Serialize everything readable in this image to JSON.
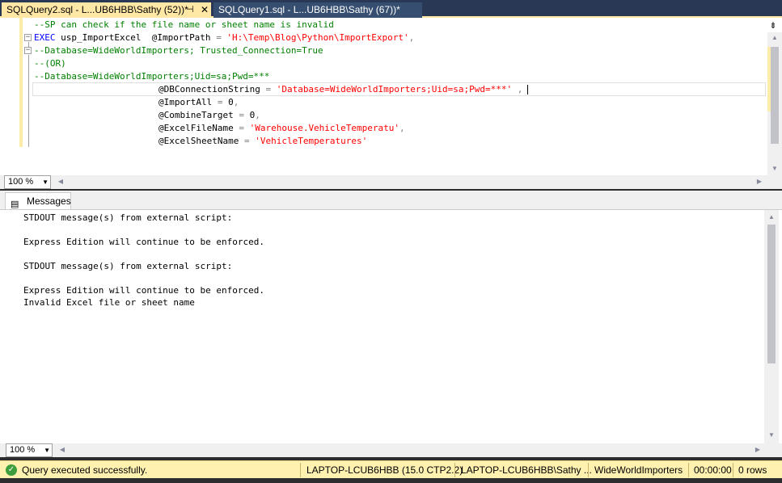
{
  "tabs": [
    {
      "label": "SQLQuery2.sql - L...UB6HBB\\Sathy (52))*",
      "pin": "⊣",
      "close": "✕"
    },
    {
      "label": "SQLQuery1.sql - L...UB6HBB\\Sathy (67))*"
    }
  ],
  "editor": {
    "lines": {
      "l1": "--SP can check if the file name or sheet name is invalid",
      "l2_kw": "EXEC",
      "l2_proc": " usp_ImportExcel  @ImportPath ",
      "l2_eq": "=",
      "l2_str": " 'H:\\Temp\\Blog\\Python\\ImportExport'",
      "l2_comma": ",",
      "l3": "--Database=WideWorldImporters; Trusted_Connection=True",
      "l4": "--(OR)",
      "l5": "--Database=WideWorldImporters;Uid=sa;Pwd=***",
      "l6_param": "@DBConnectionString ",
      "l6_eq": "=",
      "l6_str": " 'Database=WideWorldImporters;Uid=sa;Pwd=***'",
      "l6_comma": " ,",
      "l7_param": "@ImportAll ",
      "l7_eq": "=",
      "l7_val": " 0",
      "l7_comma": ",",
      "l8_param": "@CombineTarget ",
      "l8_eq": "=",
      "l8_val": " 0",
      "l8_comma": ",",
      "l9_param": "@ExcelFileName ",
      "l9_eq": "=",
      "l9_str": " 'Warehouse.VehicleTemperatu'",
      "l9_comma": ",",
      "l10_param": "@ExcelSheetName ",
      "l10_eq": "=",
      "l10_str": " 'VehicleTemperatures'"
    },
    "zoom": "100 %"
  },
  "results": {
    "tab_label": "Messages",
    "messages": [
      "STDOUT message(s) from external script:",
      "",
      "Express Edition will continue to be enforced.",
      "",
      "STDOUT message(s) from external script:",
      "",
      "Express Edition will continue to be enforced.",
      "Invalid Excel file or sheet name"
    ],
    "zoom": "100 %"
  },
  "status": {
    "message": "Query executed successfully.",
    "server": "LAPTOP-LCUB6HBB (15.0 CTP2.2)",
    "user": "LAPTOP-LCUB6HBB\\Sathy ...",
    "database": "WideWorldImporters",
    "time": "00:00:00",
    "rows": "0 rows"
  },
  "colors": {
    "comment": "#008000",
    "keyword": "#0000ff",
    "string": "#ff0000",
    "status_bg": "#fff1b0",
    "tab_active": "#ffe8a6"
  }
}
